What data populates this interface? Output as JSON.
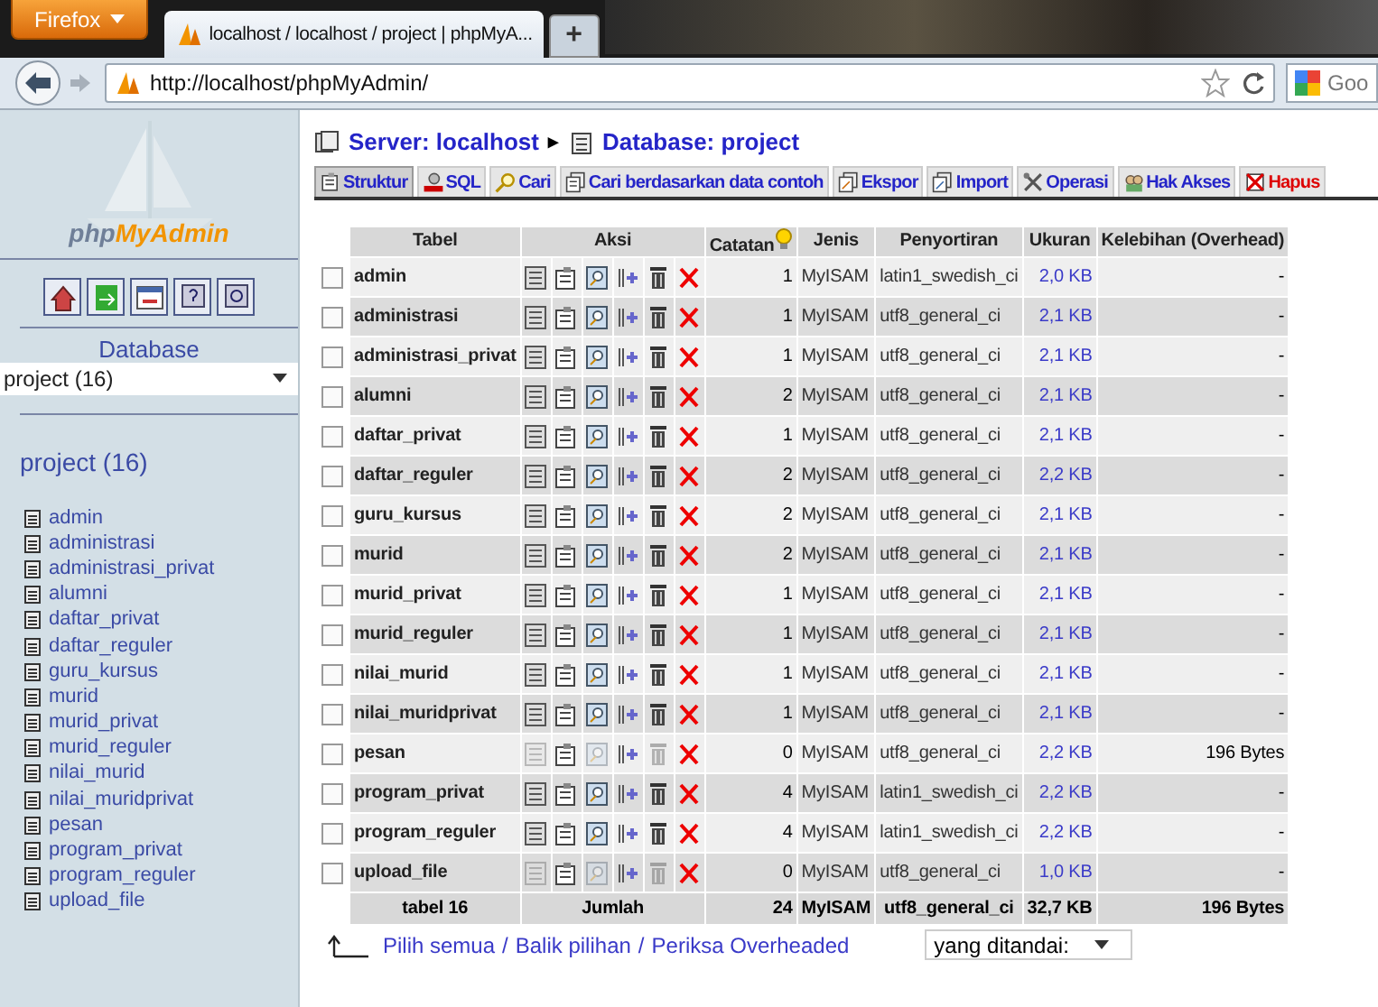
{
  "browser": {
    "menu_button": "Firefox",
    "tab_title": "localhost / localhost / project | phpMyA...",
    "new_tab": "+",
    "url": "http://localhost/phpMyAdmin/",
    "search_engine": "Goo"
  },
  "sidebar": {
    "logo_php": "php",
    "logo_myadmin": "MyAdmin",
    "database_label": "Database",
    "database_select": "project (16)",
    "database_heading": "project (16)",
    "tables": [
      "admin",
      "administrasi",
      "administrasi_privat",
      "alumni",
      "daftar_privat",
      "daftar_reguler",
      "guru_kursus",
      "murid",
      "murid_privat",
      "murid_reguler",
      "nilai_murid",
      "nilai_muridprivat",
      "pesan",
      "program_privat",
      "program_reguler",
      "upload_file"
    ]
  },
  "breadcrumb": {
    "server": "Server: localhost",
    "separator": "▸",
    "database": "Database: project"
  },
  "tabs": [
    {
      "label": "Struktur",
      "kind": "structure",
      "selected": true
    },
    {
      "label": "SQL",
      "kind": "sql",
      "selected": false
    },
    {
      "label": "Cari",
      "kind": "search",
      "selected": false
    },
    {
      "label": "Cari berdasarkan data contoh",
      "kind": "query",
      "selected": false
    },
    {
      "label": "Ekspor",
      "kind": "export",
      "selected": false
    },
    {
      "label": "Import",
      "kind": "import",
      "selected": false
    },
    {
      "label": "Operasi",
      "kind": "operations",
      "selected": false
    },
    {
      "label": "Hak Akses",
      "kind": "privileges",
      "selected": false
    },
    {
      "label": "Hapus",
      "kind": "drop",
      "selected": false
    }
  ],
  "table": {
    "columns": [
      "Tabel",
      "Aksi",
      "Catatan",
      "Jenis",
      "Penyortiran",
      "Ukuran",
      "Kelebihan (Overhead)"
    ],
    "rows": [
      {
        "name": "admin",
        "records": "1",
        "type": "MyISAM",
        "collation": "latin1_swedish_ci",
        "size": "2,0 KB",
        "overhead": "-",
        "empty": false,
        "checked": false
      },
      {
        "name": "administrasi",
        "records": "1",
        "type": "MyISAM",
        "collation": "utf8_general_ci",
        "size": "2,1 KB",
        "overhead": "-",
        "empty": false,
        "checked": false
      },
      {
        "name": "administrasi_privat",
        "records": "1",
        "type": "MyISAM",
        "collation": "utf8_general_ci",
        "size": "2,1 KB",
        "overhead": "-",
        "empty": false,
        "checked": false
      },
      {
        "name": "alumni",
        "records": "2",
        "type": "MyISAM",
        "collation": "utf8_general_ci",
        "size": "2,1 KB",
        "overhead": "-",
        "empty": false,
        "checked": false
      },
      {
        "name": "daftar_privat",
        "records": "1",
        "type": "MyISAM",
        "collation": "utf8_general_ci",
        "size": "2,1 KB",
        "overhead": "-",
        "empty": false,
        "checked": false
      },
      {
        "name": "daftar_reguler",
        "records": "2",
        "type": "MyISAM",
        "collation": "utf8_general_ci",
        "size": "2,2 KB",
        "overhead": "-",
        "empty": false,
        "checked": false
      },
      {
        "name": "guru_kursus",
        "records": "2",
        "type": "MyISAM",
        "collation": "utf8_general_ci",
        "size": "2,1 KB",
        "overhead": "-",
        "empty": false,
        "checked": false
      },
      {
        "name": "murid",
        "records": "2",
        "type": "MyISAM",
        "collation": "utf8_general_ci",
        "size": "2,1 KB",
        "overhead": "-",
        "empty": false,
        "checked": false
      },
      {
        "name": "murid_privat",
        "records": "1",
        "type": "MyISAM",
        "collation": "utf8_general_ci",
        "size": "2,1 KB",
        "overhead": "-",
        "empty": false,
        "checked": false
      },
      {
        "name": "murid_reguler",
        "records": "1",
        "type": "MyISAM",
        "collation": "utf8_general_ci",
        "size": "2,1 KB",
        "overhead": "-",
        "empty": false,
        "checked": false
      },
      {
        "name": "nilai_murid",
        "records": "1",
        "type": "MyISAM",
        "collation": "utf8_general_ci",
        "size": "2,1 KB",
        "overhead": "-",
        "empty": false,
        "checked": false
      },
      {
        "name": "nilai_muridprivat",
        "records": "1",
        "type": "MyISAM",
        "collation": "utf8_general_ci",
        "size": "2,1 KB",
        "overhead": "-",
        "empty": false,
        "checked": false
      },
      {
        "name": "pesan",
        "records": "0",
        "type": "MyISAM",
        "collation": "utf8_general_ci",
        "size": "2,2 KB",
        "overhead": "196 Bytes",
        "empty": true,
        "checked": false
      },
      {
        "name": "program_privat",
        "records": "4",
        "type": "MyISAM",
        "collation": "latin1_swedish_ci",
        "size": "2,2 KB",
        "overhead": "-",
        "empty": false,
        "checked": false
      },
      {
        "name": "program_reguler",
        "records": "4",
        "type": "MyISAM",
        "collation": "latin1_swedish_ci",
        "size": "2,2 KB",
        "overhead": "-",
        "empty": false,
        "checked": false
      },
      {
        "name": "upload_file",
        "records": "0",
        "type": "MyISAM",
        "collation": "utf8_general_ci",
        "size": "1,0 KB",
        "overhead": "-",
        "empty": true,
        "checked": false
      }
    ],
    "footer": {
      "count": "tabel 16",
      "label": "Jumlah",
      "records": "24",
      "type": "MyISAM",
      "collation": "utf8_general_ci",
      "size": "32,7 KB",
      "overhead": "196 Bytes"
    }
  },
  "bulk": {
    "links": [
      "Pilih semua",
      "Balik pilihan",
      "Periksa Overheaded"
    ],
    "separator": "/",
    "action_select": "yang ditandai:"
  }
}
